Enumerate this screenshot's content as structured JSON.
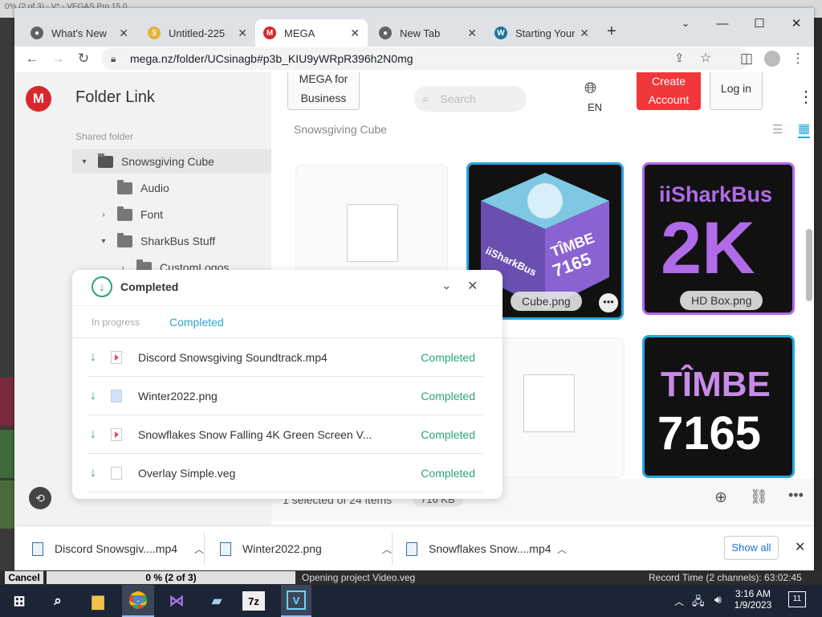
{
  "background_app": {
    "title_fragment": "0% (2 of 3) - V* - VEGAS Pro 15.0",
    "cancel_label": "Cancel",
    "progress_text": "0 % (2 of 3)",
    "status_text": "Opening project Video.veg",
    "record_time": "Record Time (2 channels): 63:02:45"
  },
  "tabs": [
    {
      "label": "What's New",
      "icon": "chrome-icon",
      "color": "#5f6368"
    },
    {
      "label": "Untitled-225 ",
      "icon": "coin-icon",
      "color": "#e8b23a"
    },
    {
      "label": "MEGA",
      "icon": "mega-icon",
      "color": "#d9272e",
      "active": true
    },
    {
      "label": "New Tab",
      "icon": "chrome-icon",
      "color": "#5f6368"
    },
    {
      "label": "Starting Your D",
      "icon": "wordpress-icon",
      "color": "#21759b"
    }
  ],
  "address_bar": {
    "url": "mega.nz/folder/UCsinagb#p3b_KIU9yWRpR396h2N0mg"
  },
  "sidebar": {
    "title": "Folder Link",
    "section_label": "Shared folder",
    "tree": [
      {
        "label": "Snowsgiving Cube",
        "caret": "▾",
        "level": 0
      },
      {
        "label": "Audio",
        "caret": "",
        "level": 1
      },
      {
        "label": "Font",
        "caret": "›",
        "level": 1
      },
      {
        "label": "SharkBus Stuff",
        "caret": "▾",
        "level": 1
      },
      {
        "label": "CustomLogos",
        "caret": "›",
        "level": 2
      }
    ]
  },
  "header": {
    "mega_for_business": "MEGA for Business",
    "search_placeholder": "Search",
    "language": "EN",
    "create_account": "Create Account",
    "login": "Log in"
  },
  "breadcrumb": "Snowsgiving Cube",
  "files": [
    {
      "name": "Cube.png",
      "selected": true
    },
    {
      "name": "HD Box.png"
    }
  ],
  "thumbnails": {
    "cube_left": "iiSharkBus",
    "cube_right_1": "TÎMBE",
    "cube_right_2": "7165",
    "hdbox_1": "iiSharkBus",
    "hdbox_2": "2K",
    "timbe_1": "TÎMBE",
    "timbe_2": "7165"
  },
  "status_bar": {
    "selection": "1 selected of 24 items",
    "size": "716 KB"
  },
  "transfer_panel": {
    "title": "Completed",
    "tab_in_progress": "In progress",
    "tab_completed": "Completed",
    "items": [
      {
        "name": "Discord Snowsgiving Soundtrack.mp4",
        "status": "Completed",
        "type": "video"
      },
      {
        "name": "Winter2022.png",
        "status": "Completed",
        "type": "image"
      },
      {
        "name": "Snowflakes Snow Falling 4K Green Screen V...",
        "status": "Completed",
        "type": "video"
      },
      {
        "name": "Overlay Simple.veg",
        "status": "Completed",
        "type": "file"
      }
    ]
  },
  "downloads": [
    {
      "name": "Discord Snowsgiv....mp4"
    },
    {
      "name": "Winter2022.png"
    },
    {
      "name": "Snowflakes Snow....mp4"
    }
  ],
  "downloads_show_all": "Show all",
  "clock": {
    "time": "3:16 AM",
    "date": "1/9/2023"
  },
  "notification_count": "11",
  "taskbar_vs_label": "V",
  "taskbar_7z_label": "7z",
  "colors": {
    "mega_red": "#d9272e",
    "completed_green": "#2ba37f",
    "selected_border": "#26a7de",
    "purple": "#b06be8"
  }
}
